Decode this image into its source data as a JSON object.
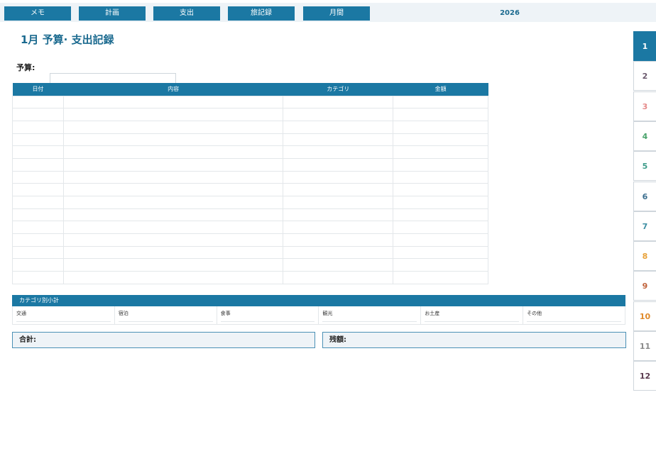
{
  "nav": {
    "tabs": [
      "メモ",
      "計画",
      "支出",
      "旅記録",
      "月間"
    ],
    "year": "2026"
  },
  "page": {
    "title": "1月 予算· 支出記録",
    "budget_label": "予算:",
    "budget_value": ""
  },
  "table": {
    "columns": [
      "日付",
      "内容",
      "カテゴリ",
      "金額"
    ],
    "rows": [
      [
        "",
        "",
        "",
        ""
      ],
      [
        "",
        "",
        "",
        ""
      ],
      [
        "",
        "",
        "",
        ""
      ],
      [
        "",
        "",
        "",
        ""
      ],
      [
        "",
        "",
        "",
        ""
      ],
      [
        "",
        "",
        "",
        ""
      ],
      [
        "",
        "",
        "",
        ""
      ],
      [
        "",
        "",
        "",
        ""
      ],
      [
        "",
        "",
        "",
        ""
      ],
      [
        "",
        "",
        "",
        ""
      ],
      [
        "",
        "",
        "",
        ""
      ],
      [
        "",
        "",
        "",
        ""
      ],
      [
        "",
        "",
        "",
        ""
      ],
      [
        "",
        "",
        "",
        ""
      ],
      [
        "",
        "",
        "",
        ""
      ]
    ]
  },
  "subtotals": {
    "title": "カテゴリ別小計",
    "categories": [
      "交通",
      "宿泊",
      "食事",
      "観光",
      "お土産",
      "その他"
    ]
  },
  "summary": {
    "total_label": "合計:",
    "remaining_label": "残額:"
  },
  "months": {
    "labels": [
      "1",
      "2",
      "3",
      "4",
      "5",
      "6",
      "7",
      "8",
      "9",
      "10",
      "11",
      "12"
    ],
    "colors": [
      "#ffffff",
      "#6b5a6e",
      "#e58a8a",
      "#4aa36c",
      "#3e9c8a",
      "#3c6f8f",
      "#3e8fa3",
      "#e8a23a",
      "#c0623a",
      "#e08a2a",
      "#8a8a8a",
      "#5a3a4e"
    ],
    "active": "1"
  },
  "colors": {
    "accent": "#1b78a3",
    "title": "#1b6a8f"
  }
}
